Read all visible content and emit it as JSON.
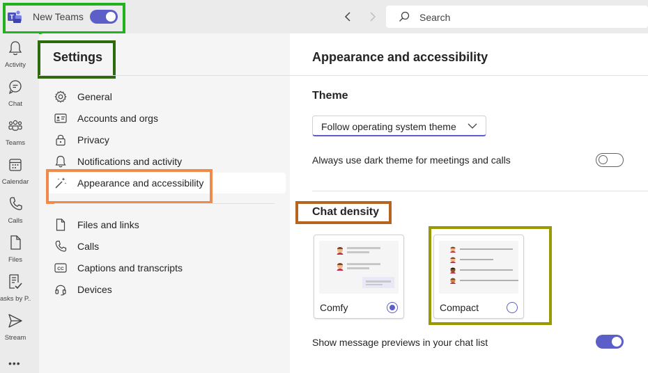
{
  "topbar": {
    "app_toggle_label": "New Teams",
    "app_toggle_on": true,
    "search_placeholder": "Search"
  },
  "rail": {
    "items": [
      {
        "label": "Activity",
        "icon": "bell-icon"
      },
      {
        "label": "Chat",
        "icon": "chat-icon"
      },
      {
        "label": "Teams",
        "icon": "teams-icon"
      },
      {
        "label": "Calendar",
        "icon": "calendar-icon"
      },
      {
        "label": "Calls",
        "icon": "phone-icon"
      },
      {
        "label": "Files",
        "icon": "file-icon"
      },
      {
        "label": "asks by P...",
        "icon": "tasks-icon"
      },
      {
        "label": "Stream",
        "icon": "stream-icon"
      }
    ],
    "more": "•••"
  },
  "settings": {
    "title": "Settings",
    "menu": [
      {
        "label": "General",
        "icon": "gear-icon"
      },
      {
        "label": "Accounts and orgs",
        "icon": "id-card-icon"
      },
      {
        "label": "Privacy",
        "icon": "lock-icon"
      },
      {
        "label": "Notifications and activity",
        "icon": "bell-icon"
      },
      {
        "label": "Appearance and accessibility",
        "icon": "magic-wand-icon",
        "active": true
      },
      {
        "label": "Files and links",
        "icon": "file-icon"
      },
      {
        "label": "Calls",
        "icon": "phone-icon"
      },
      {
        "label": "Captions and transcripts",
        "icon": "cc-icon"
      },
      {
        "label": "Devices",
        "icon": "headset-icon"
      }
    ]
  },
  "content": {
    "title": "Appearance and accessibility",
    "theme": {
      "heading": "Theme",
      "selected": "Follow operating system theme",
      "dark_meetings_label": "Always use dark theme for meetings and calls",
      "dark_meetings_on": false
    },
    "chat_density": {
      "heading": "Chat density",
      "options": [
        {
          "label": "Comfy",
          "selected": true
        },
        {
          "label": "Compact",
          "selected": false
        }
      ]
    },
    "previews": {
      "label": "Show message previews in your chat list",
      "on": true
    }
  },
  "colors": {
    "accent": "#5b5fc7",
    "highlight_green": "#22b11f",
    "highlight_dark_green": "#2e6b0f",
    "highlight_orange": "#f08a4b",
    "highlight_brown": "#b5651d",
    "highlight_olive": "#9a9a00"
  }
}
